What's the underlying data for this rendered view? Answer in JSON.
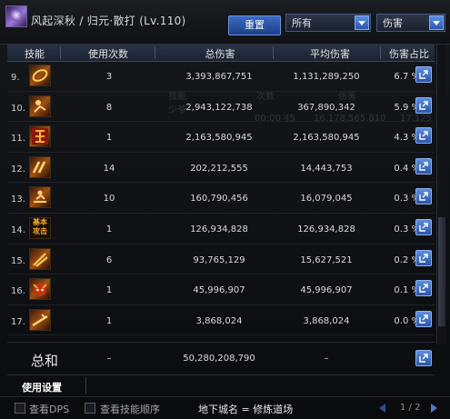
{
  "header": {
    "title": "风起深秋 / 归元·散打 (Lv.110)",
    "reset_label": "重置",
    "filter_select": "所有",
    "metric_select": "伤害"
  },
  "columns": {
    "skill": "技能",
    "uses": "使用次数",
    "total": "总伤害",
    "avg": "平均伤害",
    "pct": "伤害占比"
  },
  "rows": [
    {
      "num": "9.",
      "icon": "ring-slash-icon",
      "uses": "3",
      "total": "3,393,867,751",
      "avg": "1,131,289,250",
      "pct": "6.7 %"
    },
    {
      "num": "10.",
      "icon": "spin-kick-icon",
      "uses": "8",
      "total": "2,943,122,738",
      "avg": "367,890,342",
      "pct": "5.9 %"
    },
    {
      "num": "11.",
      "icon": "bolt-glyph-icon",
      "uses": "1",
      "total": "2,163,580,945",
      "avg": "2,163,580,945",
      "pct": "4.3 %"
    },
    {
      "num": "12.",
      "icon": "dash-strike-icon",
      "uses": "14",
      "total": "202,212,555",
      "avg": "14,443,753",
      "pct": "0.4 %"
    },
    {
      "num": "13.",
      "icon": "sliding-kick-icon",
      "uses": "10",
      "total": "160,790,456",
      "avg": "16,079,045",
      "pct": "0.3 %"
    },
    {
      "num": "14.",
      "icon": "basic-attack-icon",
      "uses": "1",
      "total": "126,934,828",
      "avg": "126,934,828",
      "pct": "0.3 %"
    },
    {
      "num": "15.",
      "icon": "claw-slash-icon",
      "uses": "6",
      "total": "93,765,129",
      "avg": "15,627,521",
      "pct": "0.2 %"
    },
    {
      "num": "16.",
      "icon": "demon-face-icon",
      "uses": "1",
      "total": "45,996,907",
      "avg": "45,996,907",
      "pct": "0.1 %"
    },
    {
      "num": "17.",
      "icon": "staff-strike-icon",
      "uses": "1",
      "total": "3,868,024",
      "avg": "3,868,024",
      "pct": "0.0 %"
    }
  ],
  "basic_icon_text": "基本\n攻击",
  "total": {
    "label": "总和",
    "uses": "–",
    "total": "50,280,208,790",
    "avg": "–"
  },
  "settings_label": "使用设置",
  "footer": {
    "show_dps": "查看DPS",
    "show_order": "查看技能顺序",
    "dungeon": "地下城名 = 修炼道场",
    "page": "1 / 2"
  },
  "background_text": [
    "技能",
    "次数",
    "伤害",
    "少爷",
    "00:00 45",
    "16,178,565,810",
    "17,125"
  ],
  "colors": {
    "accent": "#3b6cc4",
    "share_button": "#2a55a8"
  }
}
